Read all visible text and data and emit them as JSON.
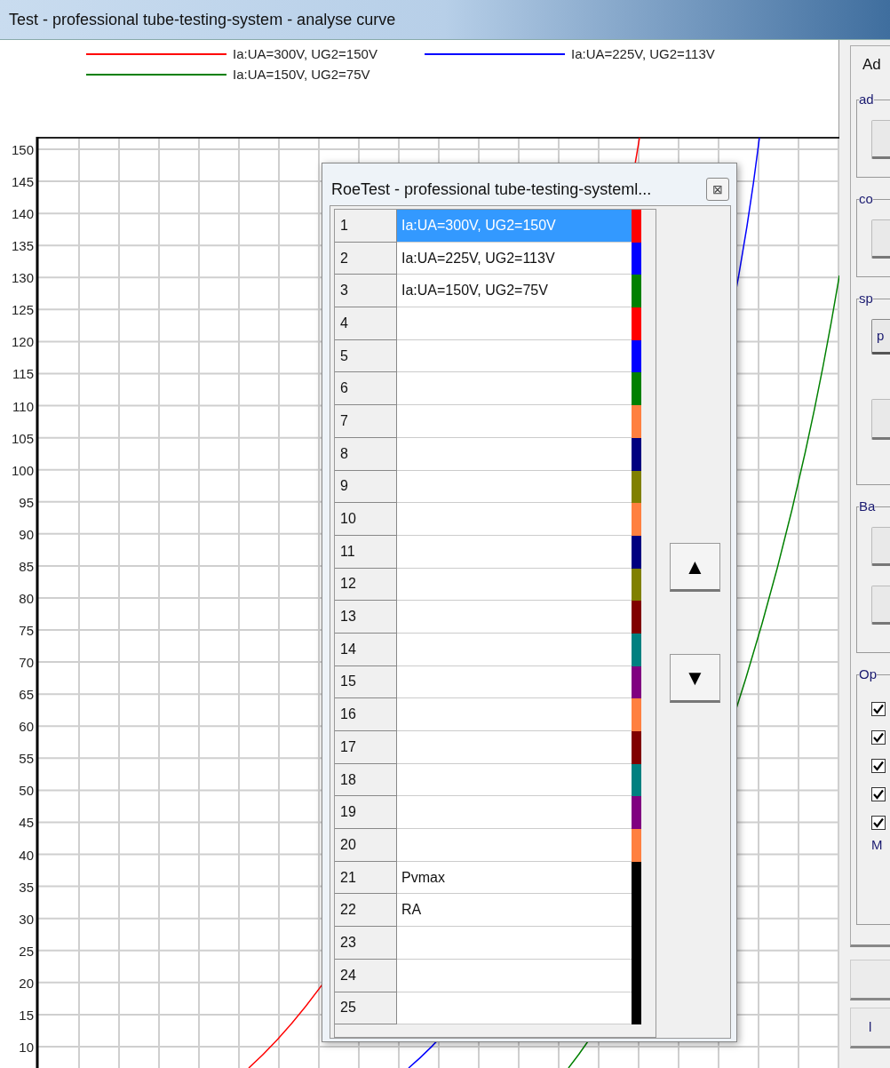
{
  "window": {
    "title": "Test - professional tube-testing-system - analyse curve"
  },
  "legend": [
    {
      "label": "Ia:UA=300V, UG2=150V",
      "color": "#ff0000"
    },
    {
      "label": "Ia:UA=225V, UG2=113V",
      "color": "#0000ff"
    },
    {
      "label": "Ia:UA=150V, UG2=75V",
      "color": "#008000"
    }
  ],
  "chart": {
    "y_ticks": [
      "150",
      "145",
      "140",
      "135",
      "130",
      "125",
      "120",
      "115",
      "110",
      "105",
      "100",
      "95",
      "90",
      "85",
      "80",
      "75",
      "70",
      "65",
      "60",
      "55",
      "50",
      "45",
      "40",
      "35",
      "30",
      "25",
      "20",
      "15",
      "10"
    ]
  },
  "dialog": {
    "title": "RoeTest - professional tube-testing-systeml...",
    "close": "⊠",
    "up": "▲",
    "down": "▼",
    "rows": [
      {
        "number": "1",
        "label": "Ia:UA=300V, UG2=150V",
        "color": "#ff0000",
        "selected": true
      },
      {
        "number": "2",
        "label": "Ia:UA=225V, UG2=113V",
        "color": "#0000ff",
        "selected": false
      },
      {
        "number": "3",
        "label": "Ia:UA=150V, UG2=75V",
        "color": "#008000",
        "selected": false
      },
      {
        "number": "4",
        "color": "#ff0000",
        "selected": false
      },
      {
        "number": "5",
        "color": "#0000ff",
        "selected": false
      },
      {
        "number": "6",
        "color": "#008000",
        "selected": false
      },
      {
        "number": "7",
        "color": "#ff8040",
        "selected": false
      },
      {
        "number": "8",
        "color": "#000080",
        "selected": false
      },
      {
        "number": "9",
        "color": "#808000",
        "selected": false
      },
      {
        "number": "10",
        "color": "#ff8040",
        "selected": false
      },
      {
        "number": "11",
        "color": "#000080",
        "selected": false
      },
      {
        "number": "12",
        "color": "#808000",
        "selected": false
      },
      {
        "number": "13",
        "color": "#800000",
        "selected": false
      },
      {
        "number": "14",
        "color": "#008080",
        "selected": false
      },
      {
        "number": "15",
        "color": "#800080",
        "selected": false
      },
      {
        "number": "16",
        "color": "#ff8040",
        "selected": false
      },
      {
        "number": "17",
        "color": "#800000",
        "selected": false
      },
      {
        "number": "18",
        "color": "#008080",
        "selected": false
      },
      {
        "number": "19",
        "color": "#800080",
        "selected": false
      },
      {
        "number": "20",
        "color": "#ff8040",
        "selected": false
      },
      {
        "number": "21",
        "label": "Pvmax",
        "color": "#000000",
        "selected": false
      },
      {
        "number": "22",
        "label": "RA",
        "color": "#000000",
        "selected": false
      },
      {
        "number": "23",
        "color": "#000000",
        "selected": false
      },
      {
        "number": "24",
        "color": "#000000",
        "selected": false
      },
      {
        "number": "25",
        "color": "#000000",
        "selected": false
      }
    ]
  },
  "side_panel": {
    "title": "Ad",
    "groups": [
      {
        "kind": "buttons",
        "label": "ad",
        "buttons": [
          {
            "kind": "plain"
          }
        ]
      },
      {
        "kind": "buttons",
        "label": "co",
        "buttons": [
          {
            "kind": "plain"
          }
        ]
      },
      {
        "kind": "field",
        "label": "sp",
        "field": "p"
      },
      {
        "kind": "buttons",
        "label": "Ba",
        "buttons": [
          {
            "kind": "plain"
          },
          {
            "kind": "plain"
          }
        ]
      },
      {
        "kind": "checks",
        "label": "Op",
        "checks": [
          {
            "checked": true
          },
          {
            "checked": true
          },
          {
            "checked": true
          },
          {
            "checked": true
          },
          {
            "checked": true
          }
        ],
        "note": "M"
      }
    ],
    "buttons": [
      {
        "label": "l"
      }
    ]
  }
}
